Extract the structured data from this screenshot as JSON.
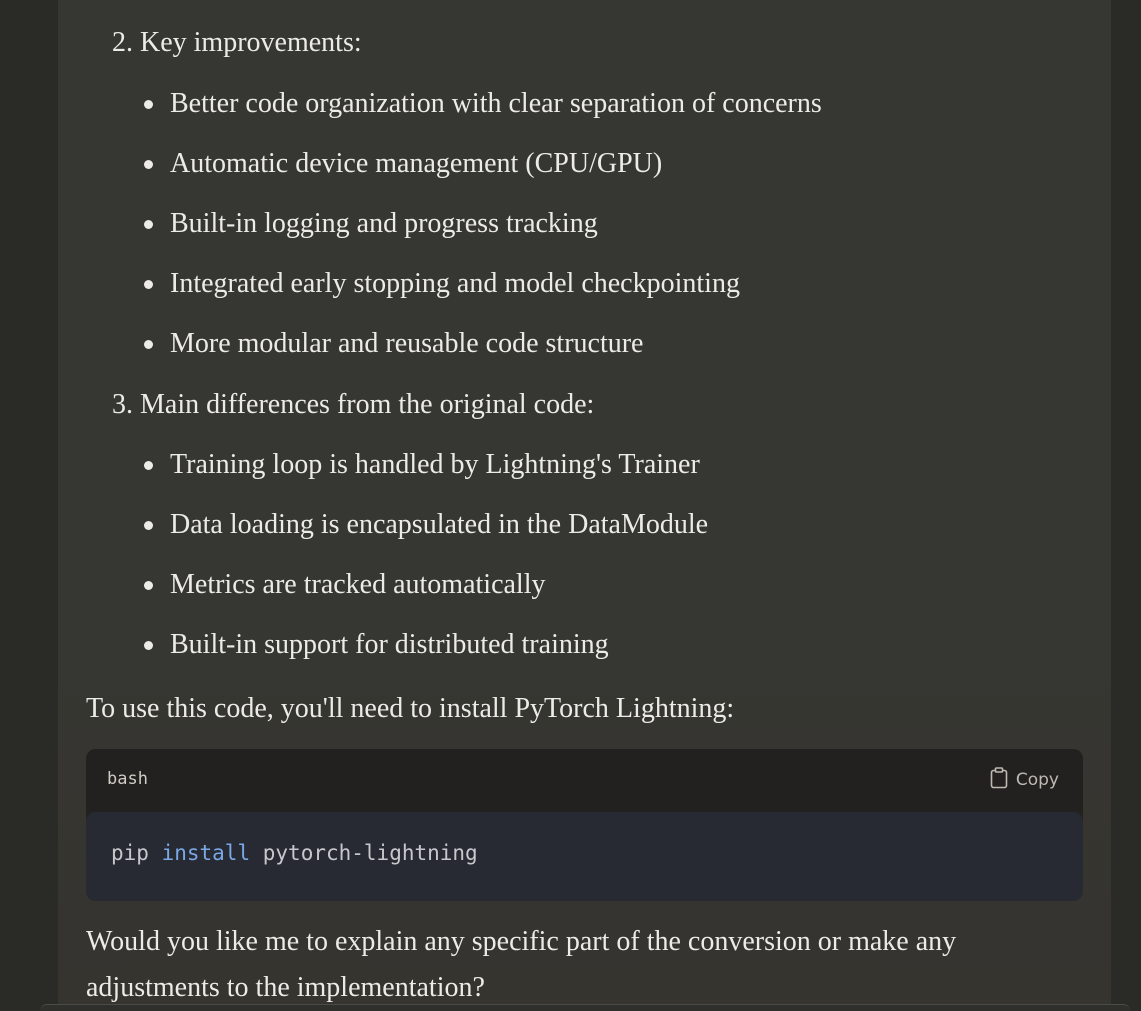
{
  "section2": {
    "heading": "2. Key improvements:",
    "bullets": [
      "Better code organization with clear separation of concerns",
      "Automatic device management (CPU/GPU)",
      "Built-in logging and progress tracking",
      "Integrated early stopping and model checkpointing",
      "More modular and reusable code structure"
    ]
  },
  "section3": {
    "heading": "3. Main differences from the original code:",
    "bullets": [
      "Training loop is handled by Lightning's Trainer",
      "Data loading is encapsulated in the DataModule",
      "Metrics are tracked automatically",
      "Built-in support for distributed training"
    ]
  },
  "install_intro": "To use this code, you'll need to install PyTorch Lightning:",
  "code": {
    "language": "bash",
    "copy_label": "Copy",
    "copy_icon": "clipboard-icon",
    "tokens": {
      "cmd": "pip",
      "keyword": "install",
      "arg": "pytorch-lightning"
    }
  },
  "closing": "Would you like me to explain any specific part of the conversion or make any adjustments to the implementation?"
}
